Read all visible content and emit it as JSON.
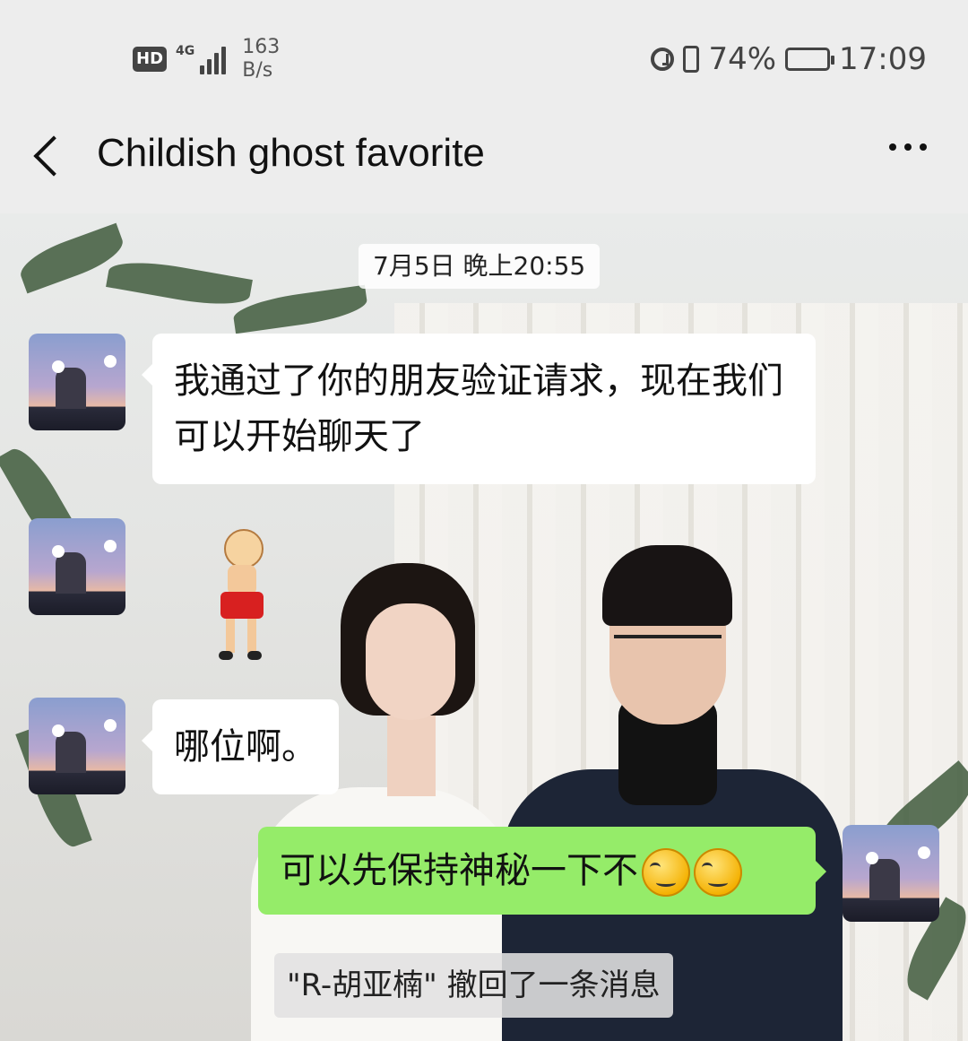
{
  "status_bar": {
    "hd_label": "HD",
    "network_label": "4G",
    "speed_value": "163",
    "speed_unit": "B/s",
    "battery_percent": "74%",
    "battery_level": 0.74,
    "time": "17:09",
    "icons": [
      "alarm-icon",
      "vibrate-icon",
      "battery-icon"
    ]
  },
  "nav": {
    "back_icon": "chevron-left-icon",
    "title": "Childish ghost favorite",
    "more_icon": "more-dots-icon"
  },
  "chat": {
    "timestamp": "7月5日 晚上20:55",
    "messages": [
      {
        "side": "left",
        "type": "text",
        "text": "我通过了你的朋友验证请求，现在我们可以开始聊天了"
      },
      {
        "side": "left",
        "type": "sticker",
        "sticker": "dancing-man-sticker"
      },
      {
        "side": "left",
        "type": "text",
        "text": "哪位啊。"
      },
      {
        "side": "right",
        "type": "text",
        "text": "可以先保持神秘一下不",
        "emoji": [
          "smirk-emoji",
          "smirk-emoji"
        ]
      }
    ],
    "system_notice": "\"R-胡亚楠\" 撤回了一条消息"
  },
  "colors": {
    "sent_bubble": "#95ec69",
    "received_bubble": "#ffffff",
    "header_bg": "#ededed"
  }
}
